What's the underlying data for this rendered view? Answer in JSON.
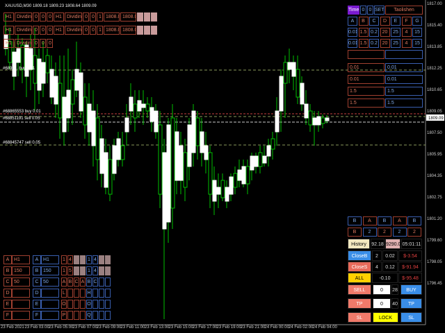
{
  "chart_title": "XAUUSD,M30  1809.18 1809.23 1808.64 1809.09",
  "price_box": "1809.09",
  "y_ticks": [
    "1817.00",
    "1815.40",
    "1813.85",
    "1812.25",
    "1810.65",
    "1809.05",
    "1807.50",
    "1805.95",
    "1804.35",
    "1802.75",
    "1801.20",
    "1799.60",
    "1798.05",
    "1796.45"
  ],
  "x_ticks": [
    "23 Feb 2021",
    "23 Feb 03:00",
    "23 Feb 05:00",
    "23 Feb 07:00",
    "23 Feb 09:00",
    "23 Feb 11:00",
    "23 Feb 13:00",
    "23 Feb 15:00",
    "23 Feb 17:00",
    "23 Feb 19:00",
    "23 Feb 21:00",
    "24 Feb 00:00",
    "24 Feb 02:00",
    "24 Feb 04:00"
  ],
  "order_lines": [
    "#6895... buy 0.01",
    "#68865553 buy 0.01",
    "#68851191 sell 0.05",
    "#68845747 sell 0.05"
  ],
  "top_left_rows": [
    [
      "H1",
      "Dividing",
      "0",
      "0",
      "0",
      "H1",
      "Dividing",
      "0",
      "0",
      "1",
      "1808.05",
      "1808.05",
      "",
      "",
      ""
    ],
    [
      "H1",
      "Dividing",
      "0",
      "0",
      "0",
      "H1",
      "Dividing",
      "0",
      "0",
      "1",
      "1808.05",
      "1808.01",
      "",
      "",
      ""
    ],
    [
      "H1",
      "Dividing",
      "0",
      "0",
      "0"
    ]
  ],
  "right_panel": {
    "time_label": "Time",
    "time_v1": "0",
    "time_v2": "0",
    "set_label": "SET",
    "user": "Taolishen",
    "letters": [
      "A",
      "B",
      "C",
      "D",
      "E",
      "F",
      "G"
    ],
    "row2": [
      "0.01",
      "1.5",
      "0.2",
      "20",
      "25",
      "4",
      "15"
    ],
    "row3": [
      "0.01",
      "1.5",
      "0.2",
      "20",
      "25",
      "4",
      "15"
    ],
    "pair_rows": [
      [
        "0.01",
        "0.01"
      ],
      [
        "0.01",
        "0.01"
      ],
      [
        "1.5",
        "1.5"
      ],
      [
        "1.5",
        "1.5"
      ]
    ],
    "lower_letters": [
      "B",
      "A",
      "B",
      "A",
      "B"
    ],
    "lower_vals": [
      "B",
      "2",
      "2",
      "2",
      "2"
    ],
    "history_label": "History",
    "history_v1": "92.18",
    "history_v2": "9290.06",
    "history_time": "05:01:11",
    "closeb_label": "CloseB",
    "closeb_n": "2",
    "closeb_lot": "0.02",
    "closeb_pl": "$-3.54",
    "closes_label": "CloseS",
    "closes_n": "4",
    "closes_lot": "0.12",
    "closes_pl": "$-91.94",
    "all_label": "ALL",
    "all_lot": "-0.10",
    "all_pl": "$-95.48",
    "sell_label": "SELL",
    "sell_input": "0",
    "sell_n": "28",
    "buy_label": "BUY",
    "tp_label": "TP",
    "tp_input": "0",
    "tp_n": "40",
    "tp2_label": "TP",
    "sl_label": "SL",
    "lock_label": "LOCK",
    "sl2_label": "SL"
  },
  "bottom_left": {
    "col1": [
      [
        "A",
        "H1"
      ],
      [
        "B",
        "150"
      ],
      [
        "C",
        "50"
      ],
      [
        "D",
        ""
      ],
      [
        "E",
        ""
      ],
      [
        "F",
        ""
      ]
    ],
    "col2": [
      [
        "A",
        "H1"
      ],
      [
        "B",
        "150"
      ],
      [
        "C",
        "50"
      ],
      [
        "D",
        ""
      ],
      [
        "E",
        ""
      ],
      [
        "F",
        ""
      ]
    ],
    "col3": [
      [
        "1",
        "4",
        "",
        ""
      ],
      [
        "1",
        "5",
        "",
        ""
      ],
      [
        "A",
        "B",
        "C",
        "A"
      ],
      [
        "L",
        "",
        "",
        ""
      ],
      [
        "O",
        "",
        "",
        ""
      ],
      [
        "P",
        "",
        "",
        ""
      ]
    ],
    "col3b": [
      [
        "1",
        "4",
        "",
        ""
      ],
      [
        "1",
        "4",
        "",
        ""
      ],
      [
        "B",
        "C",
        "",
        ""
      ],
      [
        "H",
        "",
        "",
        ""
      ],
      [
        "O",
        "",
        "",
        ""
      ],
      [
        "Q",
        "",
        "",
        ""
      ]
    ]
  },
  "colors": {
    "bull": "#ffffff",
    "bear": "#000000",
    "wick": "#00c000",
    "grid": "#556b2f",
    "up_line": "#c84040"
  }
}
